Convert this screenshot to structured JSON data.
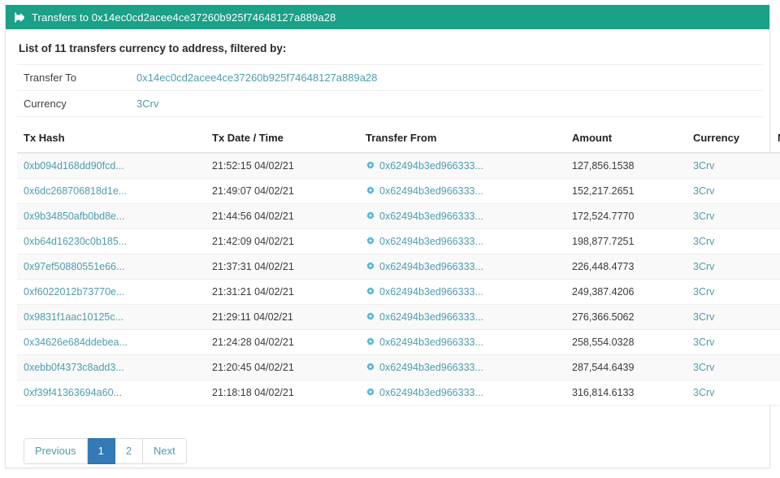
{
  "header": {
    "icon": "sign-in-icon",
    "title": "Transfers to 0x14ec0cd2acee4ce37260b925f74648127a889a28",
    "bg_color": "#1aa188"
  },
  "caption": "List of 11 transfers currency to address, filtered by:",
  "filters": [
    {
      "label": "Transfer To",
      "value": "0x14ec0cd2acee4ce37260b925f74648127a889a28"
    },
    {
      "label": "Currency",
      "value": "3Crv"
    }
  ],
  "table": {
    "columns": [
      "Tx Hash",
      "Tx Date / Time",
      "Transfer From",
      "Amount",
      "Currency",
      "Note"
    ],
    "row_icon": "gear-icon",
    "rows": [
      {
        "tx_hash": "0xb094d168dd90fcd...",
        "date_time": "21:52:15 04/02/21",
        "transfer_from": "0x62494b3ed966333...",
        "amount": "127,856.1538",
        "currency": "3Crv",
        "note": ""
      },
      {
        "tx_hash": "0x6dc268706818d1e...",
        "date_time": "21:49:07 04/02/21",
        "transfer_from": "0x62494b3ed966333...",
        "amount": "152,217.2651",
        "currency": "3Crv",
        "note": ""
      },
      {
        "tx_hash": "0x9b34850afb0bd8e...",
        "date_time": "21:44:56 04/02/21",
        "transfer_from": "0x62494b3ed966333...",
        "amount": "172,524.7770",
        "currency": "3Crv",
        "note": ""
      },
      {
        "tx_hash": "0xb64d16230c0b185...",
        "date_time": "21:42:09 04/02/21",
        "transfer_from": "0x62494b3ed966333...",
        "amount": "198,877.7251",
        "currency": "3Crv",
        "note": ""
      },
      {
        "tx_hash": "0x97ef50880551e66...",
        "date_time": "21:37:31 04/02/21",
        "transfer_from": "0x62494b3ed966333...",
        "amount": "226,448.4773",
        "currency": "3Crv",
        "note": ""
      },
      {
        "tx_hash": "0xf6022012b73770e...",
        "date_time": "21:31:21 04/02/21",
        "transfer_from": "0x62494b3ed966333...",
        "amount": "249,387.4206",
        "currency": "3Crv",
        "note": ""
      },
      {
        "tx_hash": "0x9831f1aac10125c...",
        "date_time": "21:29:11 04/02/21",
        "transfer_from": "0x62494b3ed966333...",
        "amount": "276,366.5062",
        "currency": "3Crv",
        "note": ""
      },
      {
        "tx_hash": "0x34626e684ddebea...",
        "date_time": "21:24:28 04/02/21",
        "transfer_from": "0x62494b3ed966333...",
        "amount": "258,554.0328",
        "currency": "3Crv",
        "note": ""
      },
      {
        "tx_hash": "0xebb0f4373c8add3...",
        "date_time": "21:20:45 04/02/21",
        "transfer_from": "0x62494b3ed966333...",
        "amount": "287,544.6439",
        "currency": "3Crv",
        "note": ""
      },
      {
        "tx_hash": "0xf39f41363694a60...",
        "date_time": "21:18:18 04/02/21",
        "transfer_from": "0x62494b3ed966333...",
        "amount": "316,814.6133",
        "currency": "3Crv",
        "note": ""
      }
    ]
  },
  "pagination": {
    "previous_label": "Previous",
    "pages": [
      "1",
      "2"
    ],
    "active_page": "1",
    "next_label": "Next",
    "active_color": "#337ab7"
  },
  "colors": {
    "link": "#4e9cae",
    "teal": "#1aa188",
    "row_stripe": "#f9f9f9"
  }
}
